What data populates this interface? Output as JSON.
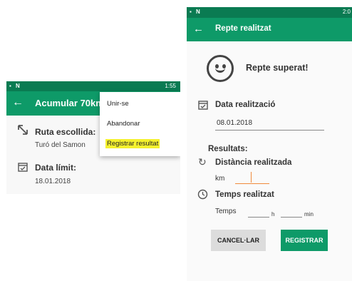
{
  "left": {
    "status": {
      "icons": "▪ N",
      "time": "1:55"
    },
    "appbar": {
      "back": "←",
      "title": "Acumular 70km"
    },
    "route": {
      "label": "Ruta escollida:",
      "value": "Turó del Samon"
    },
    "deadline": {
      "label": "Data límit:",
      "value": "18.01.2018"
    },
    "menu": {
      "items": [
        "Unir-se",
        "Abandonar",
        "Registrar resultat"
      ]
    }
  },
  "right": {
    "status": {
      "icons": "▪ N",
      "time": "2:0"
    },
    "appbar": {
      "back": "←",
      "title": "Repte realitzat"
    },
    "heading": "Repte superat!",
    "date": {
      "label": "Data realització",
      "value": "08.01.2018"
    },
    "results_label": "Resultats:",
    "distance": {
      "label": "Distància realitzada",
      "unit": "km"
    },
    "time": {
      "label": "Temps realitzat",
      "prefix": "Temps",
      "h": "h",
      "min": "min"
    },
    "buttons": {
      "cancel": "CANCEL·LAR",
      "register": "REGISTRAR"
    }
  },
  "colors": {
    "primary": "#0e9a68",
    "status": "#0a7b52",
    "highlight": "#f4f12e",
    "cursor": "#f08a3c"
  }
}
